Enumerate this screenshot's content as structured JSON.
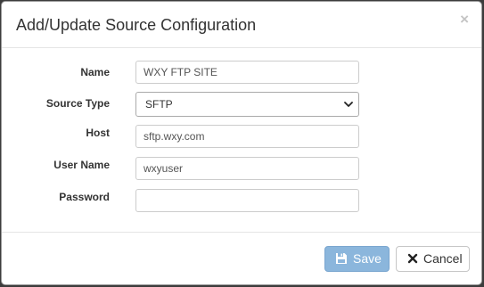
{
  "dialog": {
    "title": "Add/Update Source Configuration",
    "close_glyph": "×"
  },
  "form": {
    "name": {
      "label": "Name",
      "value": "WXY FTP SITE"
    },
    "source_type": {
      "label": "Source Type",
      "value": "SFTP",
      "icon": "chevron-down-icon"
    },
    "host": {
      "label": "Host",
      "value": "sftp.wxy.com"
    },
    "user_name": {
      "label": "User Name",
      "value": "wxyuser"
    },
    "password": {
      "label": "Password",
      "value": ""
    }
  },
  "footer": {
    "save_label": "Save",
    "save_icon": "floppy-disk-icon",
    "cancel_label": "Cancel",
    "cancel_icon": "close-icon"
  },
  "colors": {
    "save_button": "#8bb6dc",
    "backdrop": "#3c3c3c"
  }
}
